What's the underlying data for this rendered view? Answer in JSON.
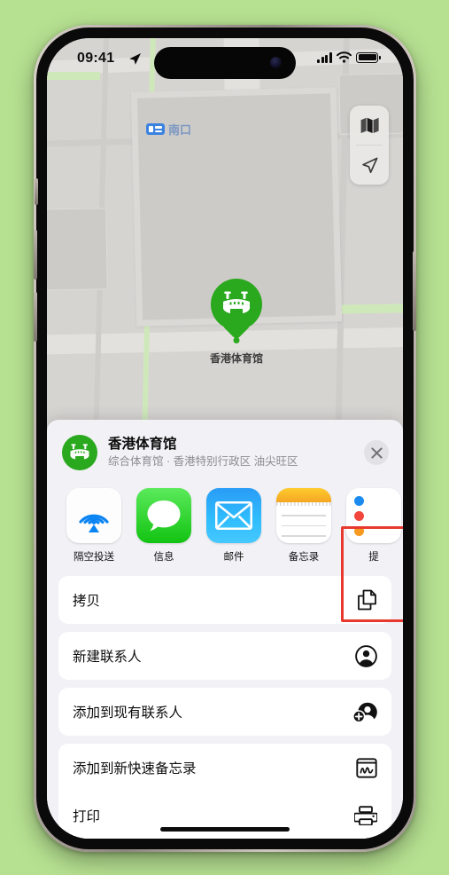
{
  "theme": {
    "background": "#b6e191",
    "accent_green": "#2aa81e",
    "highlight_red": "#e8392f",
    "sheet_bg": "#f2f1f6"
  },
  "status_bar": {
    "time": "09:41",
    "location_arrow_icon": "location-arrow-icon",
    "signal_icon": "cellular-signal-icon",
    "wifi_icon": "wifi-icon",
    "battery_icon": "battery-full-icon"
  },
  "map": {
    "exit_badge_label": "南口",
    "exit_badge_icon": "transit-exit-icon",
    "pin_label": "香港体育馆",
    "pin_icon": "stadium-icon",
    "controls": [
      {
        "name": "map-type-button",
        "icon": "folded-map-icon"
      },
      {
        "name": "locate-me-button",
        "icon": "location-arrow-icon"
      }
    ]
  },
  "share_sheet": {
    "title": "香港体育馆",
    "subtitle": "综合体育馆 · 香港特别行政区 油尖旺区",
    "avatar_icon": "stadium-icon",
    "close_icon": "close-icon",
    "apps": [
      {
        "label": "隔空投送",
        "icon": "airdrop-icon",
        "highlighted": false
      },
      {
        "label": "信息",
        "icon": "messages-icon",
        "highlighted": false
      },
      {
        "label": "邮件",
        "icon": "mail-icon",
        "highlighted": false
      },
      {
        "label": "备忘录",
        "icon": "notes-icon",
        "highlighted": true
      },
      {
        "label": "提",
        "icon": "reminders-icon",
        "highlighted": false
      }
    ],
    "actions": [
      {
        "label": "拷贝",
        "icon": "copy-icon"
      },
      {
        "label": "新建联系人",
        "icon": "person-circle-icon"
      },
      {
        "label": "添加到现有联系人",
        "icon": "person-add-icon"
      },
      {
        "label": "添加到新快速备忘录",
        "icon": "quick-note-icon"
      },
      {
        "label": "打印",
        "icon": "printer-icon"
      }
    ]
  }
}
